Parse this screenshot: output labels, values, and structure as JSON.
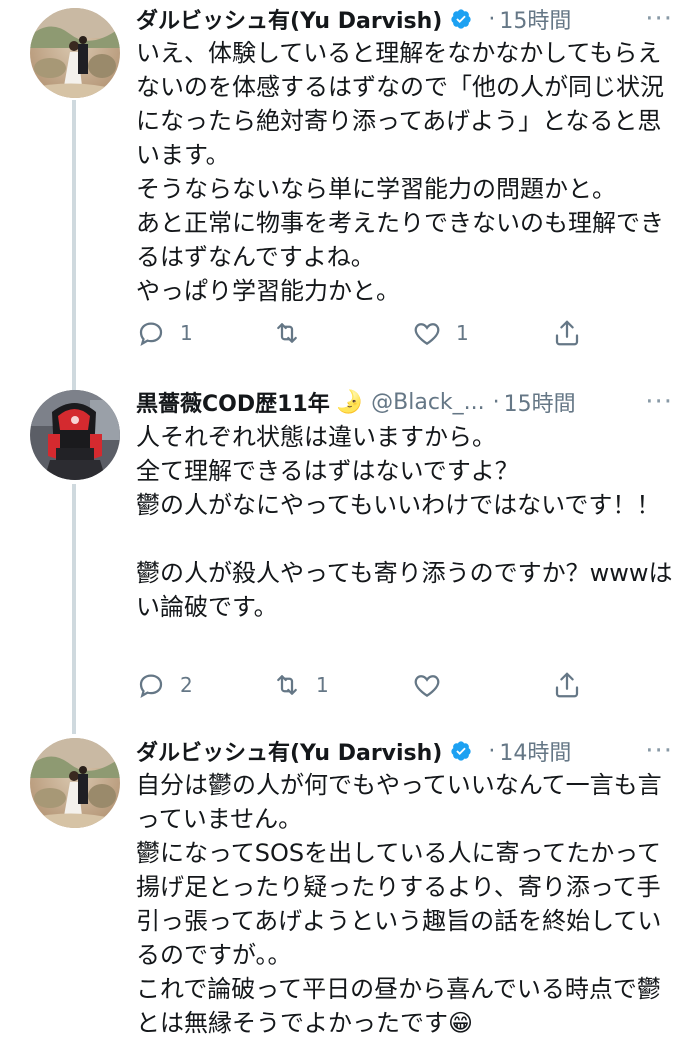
{
  "tweets": [
    {
      "name": "ダルビッシュ有(Yu Darvish)",
      "handle": "",
      "time": "15時間",
      "text": "いえ、体験していると理解をなかなかしてもらえないのを体感するはずなので「他の人が同じ状況になったら絶対寄り添ってあげよう」となると思います。\nそうならないなら単に学習能力の問題かと。\nあと正常に物事を考えたりできないのも理解できるはずなんですよね。\nやっぱり学習能力かと。",
      "reply_count": "1",
      "retweet_count": "",
      "like_count": "1"
    },
    {
      "name": "黒薔薇COD歴11年",
      "handle": "@Black_...",
      "time": "15時間",
      "text": "人それぞれ状態は違いますから。\n全て理解できるはずはないですよ？\n鬱の人がなにやってもいいわけではないです！！\n\n鬱の人が殺人やっても寄り添うのですか？wwwはい論破です。",
      "reply_count": "2",
      "retweet_count": "1",
      "like_count": ""
    },
    {
      "name": "ダルビッシュ有(Yu Darvish)",
      "handle": "",
      "time": "14時間",
      "text": "自分は鬱の人が何でもやっていいなんて一言も言っていません。\n鬱になってSOSを出している人に寄ってたかって揚げ足とったり疑ったりするより、寄り添って手引っ張ってあげようという趣旨の話を終始しているのですが。。\nこれで論破って平日の昼から喜んでいる時点で鬱とは無縁そうでよかったです😁",
      "reply_count": "",
      "retweet_count": "",
      "like_count": ""
    }
  ],
  "separator": "·",
  "more_glyph": "···",
  "moon_glyph": "🌛",
  "icons": {
    "verified": "verified-badge-icon",
    "reply": "reply-icon",
    "retweet": "retweet-icon",
    "like": "heart-icon",
    "share": "share-icon",
    "more": "more-options-icon"
  },
  "colors": {
    "text": "#14171a",
    "secondary": "#657786",
    "verified": "#1da1f2",
    "thread_line": "#cfd9de"
  }
}
